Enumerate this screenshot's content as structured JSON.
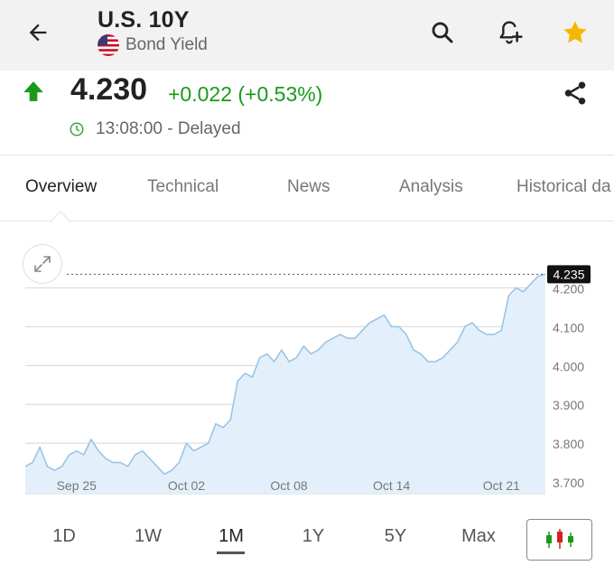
{
  "header": {
    "title": "U.S. 10Y",
    "subtitle": "Bond Yield",
    "back_icon": "arrow-left-icon",
    "search_icon": "search-icon",
    "alert_icon": "bell-plus-icon",
    "favorite_icon": "star-icon",
    "favorite_color": "#f5b800"
  },
  "quote": {
    "price": "4.230",
    "change": "+0.022 (+0.53%)",
    "time": "13:08:00 - Delayed",
    "up_color": "#1a9a1a"
  },
  "tabs": [
    {
      "label": "Overview",
      "active": true
    },
    {
      "label": "Technical",
      "active": false
    },
    {
      "label": "News",
      "active": false
    },
    {
      "label": "Analysis",
      "active": false
    },
    {
      "label": "Historical da",
      "active": false
    }
  ],
  "ranges": [
    {
      "label": "1D",
      "active": false
    },
    {
      "label": "1W",
      "active": false
    },
    {
      "label": "1M",
      "active": true
    },
    {
      "label": "1Y",
      "active": false
    },
    {
      "label": "5Y",
      "active": false
    },
    {
      "label": "Max",
      "active": false
    }
  ],
  "chart_data": {
    "type": "area",
    "last_value_label": "4.235",
    "y_ticks": [
      "4.200",
      "4.100",
      "4.000",
      "3.900",
      "3.800",
      "3.700"
    ],
    "ylim": [
      3.67,
      4.28
    ],
    "x_ticks": [
      {
        "label": "Sep 25",
        "index": 7
      },
      {
        "label": "Oct 02",
        "index": 22
      },
      {
        "label": "Oct 08",
        "index": 36
      },
      {
        "label": "Oct 14",
        "index": 50
      },
      {
        "label": "Oct 21",
        "index": 65
      }
    ],
    "values": [
      3.74,
      3.75,
      3.79,
      3.74,
      3.73,
      3.74,
      3.77,
      3.78,
      3.77,
      3.81,
      3.78,
      3.76,
      3.75,
      3.75,
      3.74,
      3.77,
      3.78,
      3.76,
      3.74,
      3.72,
      3.73,
      3.75,
      3.8,
      3.78,
      3.79,
      3.8,
      3.85,
      3.84,
      3.86,
      3.96,
      3.98,
      3.97,
      4.02,
      4.03,
      4.01,
      4.04,
      4.01,
      4.02,
      4.05,
      4.03,
      4.04,
      4.06,
      4.07,
      4.08,
      4.07,
      4.07,
      4.09,
      4.11,
      4.12,
      4.13,
      4.1,
      4.1,
      4.08,
      4.04,
      4.03,
      4.01,
      4.01,
      4.02,
      4.04,
      4.06,
      4.1,
      4.11,
      4.09,
      4.08,
      4.08,
      4.09,
      4.18,
      4.2,
      4.19,
      4.21,
      4.23,
      4.235
    ],
    "line_color": "#9cc4e4",
    "fill_color": "#e3f0fb",
    "grid": true
  }
}
